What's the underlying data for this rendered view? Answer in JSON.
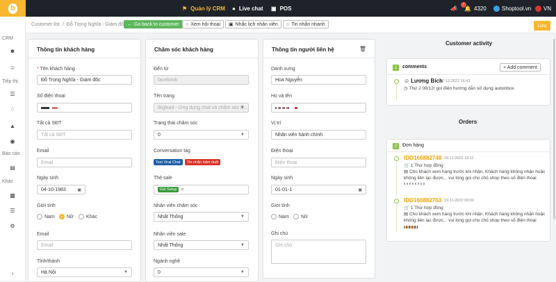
{
  "topbar": {
    "nav": [
      {
        "label": "Quản lý CRM",
        "icon": "briefcase-icon"
      },
      {
        "label": "Live chat",
        "icon": "chat-icon"
      },
      {
        "label": "POS",
        "icon": "pos-icon"
      }
    ],
    "notification_count": "7",
    "points": "4320",
    "shop_name": "Shoptool.vn",
    "language": "VN"
  },
  "sidebar": {
    "sections": [
      "CRM",
      "Tiếp thị",
      "Báo cáo",
      "Khác"
    ]
  },
  "subbar": {
    "breadcrumb": [
      "Customer list",
      "/",
      "Đỗ Trọng Nghĩa - Giám đốc"
    ],
    "back_label": "Go back to customer",
    "history_label": "Xem hội thoại",
    "reminder_label": "Nhắc lịch nhân viên",
    "quick_msg_label": "Tin nhắn nhanh",
    "save_label": "Lưu"
  },
  "customer_info": {
    "title": "Thông tin khách hàng",
    "name_label": "Tên khách hàng",
    "name_required": "*",
    "name_value": "Đỗ Trọng Nghĩa - Giám đốc",
    "phone_label": "Số điện thoại",
    "all_phone_label": "Tất cả SĐT",
    "all_phone_placeholder": "Tất cả SĐT",
    "email_label": "Email",
    "email_placeholder": "Email",
    "dob_label": "Ngày sinh",
    "dob_value": "04-10-1983",
    "gender_label": "Giới tính",
    "gender_options": [
      "Nam",
      "Nữ",
      "Khác"
    ],
    "gender_selected": "Nữ",
    "email2_label": "Email",
    "email2_placeholder": "Email",
    "province_label": "Tỉnh/thành",
    "province_value": "Hà Nội"
  },
  "care": {
    "title": "Chăm sóc khách hàng",
    "source_label": "Đến từ",
    "source_value": "facebook",
    "page_label": "Tên trang",
    "page_value": "Biglead - Ứng dụng chat và chăm sóc k...",
    "status_label": "Trạng thái chăm sóc",
    "status_value": "0",
    "conv_tag_label": "Conversation tag",
    "conv_tags": [
      {
        "label": "Test Viral Chat",
        "color": "#1d5fa8"
      },
      {
        "label": "Tin nhắn bấm duổi",
        "color": "#d9342b"
      }
    ],
    "tags_label": "Thẻ sale",
    "tag_value": "Gói Setup",
    "tag_color": "#3a9a3a",
    "staff_care_label": "Nhân viên chăm sóc",
    "staff_care_value": "Nhất Thống",
    "staff_sale_label": "Nhân viên sale",
    "staff_sale_value": "Nhất Thống",
    "industry_label": "Ngành nghề",
    "industry_value": "0"
  },
  "contact": {
    "title": "Thông tin người liên hệ",
    "salutation_label": "Danh xưng",
    "salutation_value": "Hoa Nguyễn",
    "fullname_label": "Họ và tên",
    "position_label": "Vị trí",
    "position_value": "Nhân viên hành chính",
    "phone_label": "Điện thoại",
    "phone_placeholder": "Điện thoại",
    "dob_label": "Ngày sinh",
    "dob_value": "01-01-1",
    "gender_label": "Giới tính",
    "gender_options": [
      "Nam",
      "Nữ"
    ],
    "note_label": "Ghi chú",
    "note_placeholder": "Ghi chú"
  },
  "activity": {
    "title": "Customer activity",
    "comments_count": "1",
    "comments_label": "comments",
    "add_comment_label": "+ Add comment",
    "comment_author": "Lương Bích",
    "comment_time": "17-12-2022 16:43",
    "comment_text": "Thứ 2 08/12/ gọi điện hướng dẫn sử dụng autoinbox"
  },
  "orders": {
    "title": "Orders",
    "count": "2",
    "label": "Đơn hàng",
    "items": [
      {
        "id": "IDO166882748",
        "date": "19-11-2022 10:11",
        "contract": "1 Thư hợp đồng",
        "note": "Cho khách xem hàng trước khi nhận. Khách hàng không nhận hoặc không liên lạc được... vui lòng gọi cho chủ shop theo số điện thoại"
      },
      {
        "id": "IDO166882763",
        "date": "19-11-2022 00:00",
        "contract": "1 Thư hợp đồng",
        "note": "Cho khách xem hàng trước khi nhận. Khách hàng không nhận hoặc không liên lạc được... vui lòng gọi cho chủ shop theo số điện thoại"
      }
    ]
  }
}
